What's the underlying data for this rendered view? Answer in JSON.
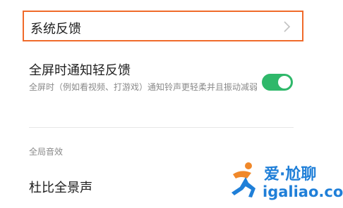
{
  "settings": {
    "feedback_row": {
      "label": "系统反馈",
      "chevron_icon": "chevron-right-icon"
    },
    "fullscreen_row": {
      "title": "全屏时通知轻反馈",
      "description": "全屏时（例如看视频、打游戏）通知铃声更轻柔并且振动减弱",
      "toggle_on": true
    },
    "section_header": "全局音效",
    "dolby_row": {
      "label": "杜比全景声"
    }
  },
  "watermark": {
    "brand": "爱·尬聊",
    "url": "igaliao.com",
    "icon": "running-figure-logo"
  },
  "colors": {
    "highlight_border": "#f06a2a",
    "toggle_on": "#2fb86a",
    "watermark_blue": "#1f7fd8",
    "watermark_orange": "#f0882a"
  }
}
